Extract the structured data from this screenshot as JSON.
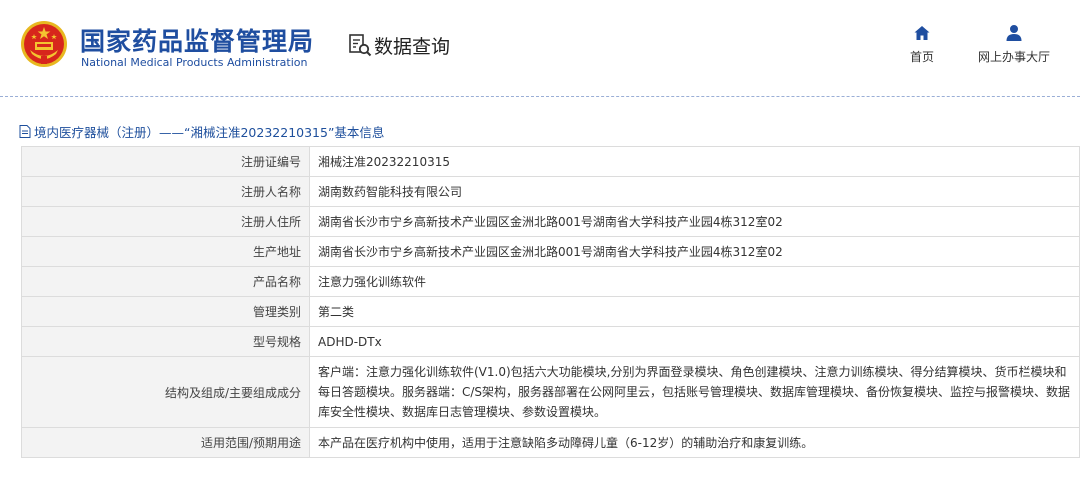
{
  "header": {
    "brand_cn": "国家药品监督管理局",
    "brand_en": "National Medical Products Administration",
    "query_label": "数据查询",
    "nav": {
      "home_label": "首页",
      "hall_label": "网上办事大厅"
    }
  },
  "breadcrumb": {
    "text": "境内医疗器械（注册）——“湘械注准20232210315”基本信息"
  },
  "details": {
    "rows": [
      {
        "label": "注册证编号",
        "value": "湘械注准20232210315"
      },
      {
        "label": "注册人名称",
        "value": "湖南数药智能科技有限公司"
      },
      {
        "label": "注册人住所",
        "value": "湖南省长沙市宁乡高新技术产业园区金洲北路001号湖南省大学科技产业园4栋312室02"
      },
      {
        "label": "生产地址",
        "value": "湖南省长沙市宁乡高新技术产业园区金洲北路001号湖南省大学科技产业园4栋312室02"
      },
      {
        "label": "产品名称",
        "value": "注意力强化训练软件"
      },
      {
        "label": "管理类别",
        "value": "第二类"
      },
      {
        "label": "型号规格",
        "value": "ADHD-DTx"
      },
      {
        "label": "结构及组成/主要组成成分",
        "value": "客户端：注意力强化训练软件(V1.0)包括六大功能模块,分别为界面登录模块、角色创建模块、注意力训练模块、得分结算模块、货币栏模块和每日答题模块。服务器端：C/S架构，服务器部署在公网阿里云，包括账号管理模块、数据库管理模块、备份恢复模块、监控与报警模块、数据库安全性模块、数据库日志管理模块、参数设置模块。"
      },
      {
        "label": "适用范围/预期用途",
        "value": "本产品在医疗机构中使用，适用于注意缺陷多动障碍儿童（6-12岁）的辅助治疗和康复训练。"
      }
    ]
  },
  "colors": {
    "brand_blue": "#1f4ea0",
    "emblem_red": "#d7261c",
    "emblem_gold": "#f4c430",
    "label_bg": "#f3f3f3",
    "border": "#dcdcdc"
  },
  "icons": [
    "national-emblem-icon",
    "data-query-icon",
    "home-icon",
    "user-icon",
    "document-icon"
  ]
}
